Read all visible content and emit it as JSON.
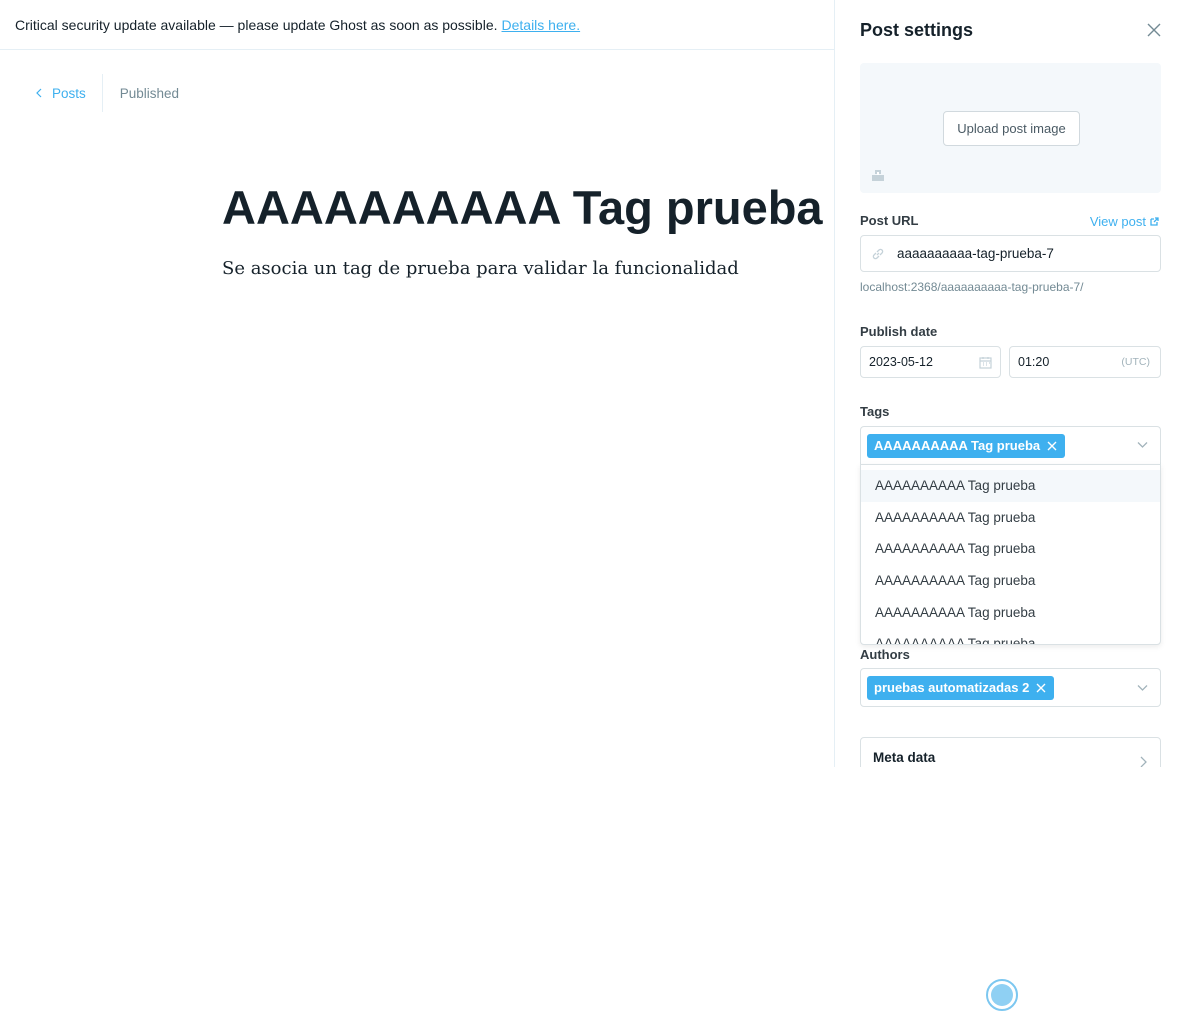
{
  "banner": {
    "message": "Critical security update available — please update Ghost as soon as possible.",
    "link": "Details here."
  },
  "editor": {
    "back_label": "Posts",
    "status": "Published",
    "title": "AAAAAAAAAA Tag prueba",
    "body": "Se asocia un tag de prueba para validar la funcionalidad"
  },
  "settings": {
    "title": "Post settings",
    "upload_label": "Upload post image",
    "url_label": "Post URL",
    "view_post": "View post",
    "slug": "aaaaaaaaaa-tag-prueba-7",
    "url_hint": "localhost:2368/aaaaaaaaaa-tag-prueba-7/",
    "publish_label": "Publish date",
    "date": "2023-05-12",
    "time": "01:20",
    "timezone": "(UTC)",
    "tags_label": "Tags",
    "selected_tag": "AAAAAAAAAA Tag prueba",
    "tag_options": [
      "AAAAAAAAAA Tag prueba",
      "AAAAAAAAAA Tag prueba",
      "AAAAAAAAAA Tag prueba",
      "AAAAAAAAAA Tag prueba",
      "AAAAAAAAAA Tag prueba",
      "AAAAAAAAAA Tag prueba"
    ],
    "authors_label": "Authors",
    "author": "pruebas automatizadas 2",
    "meta_label": "Meta data"
  },
  "colors": {
    "accent": "#3eb0ef",
    "text": "#15212a",
    "muted": "#738a94",
    "border": "#dae1e4"
  }
}
